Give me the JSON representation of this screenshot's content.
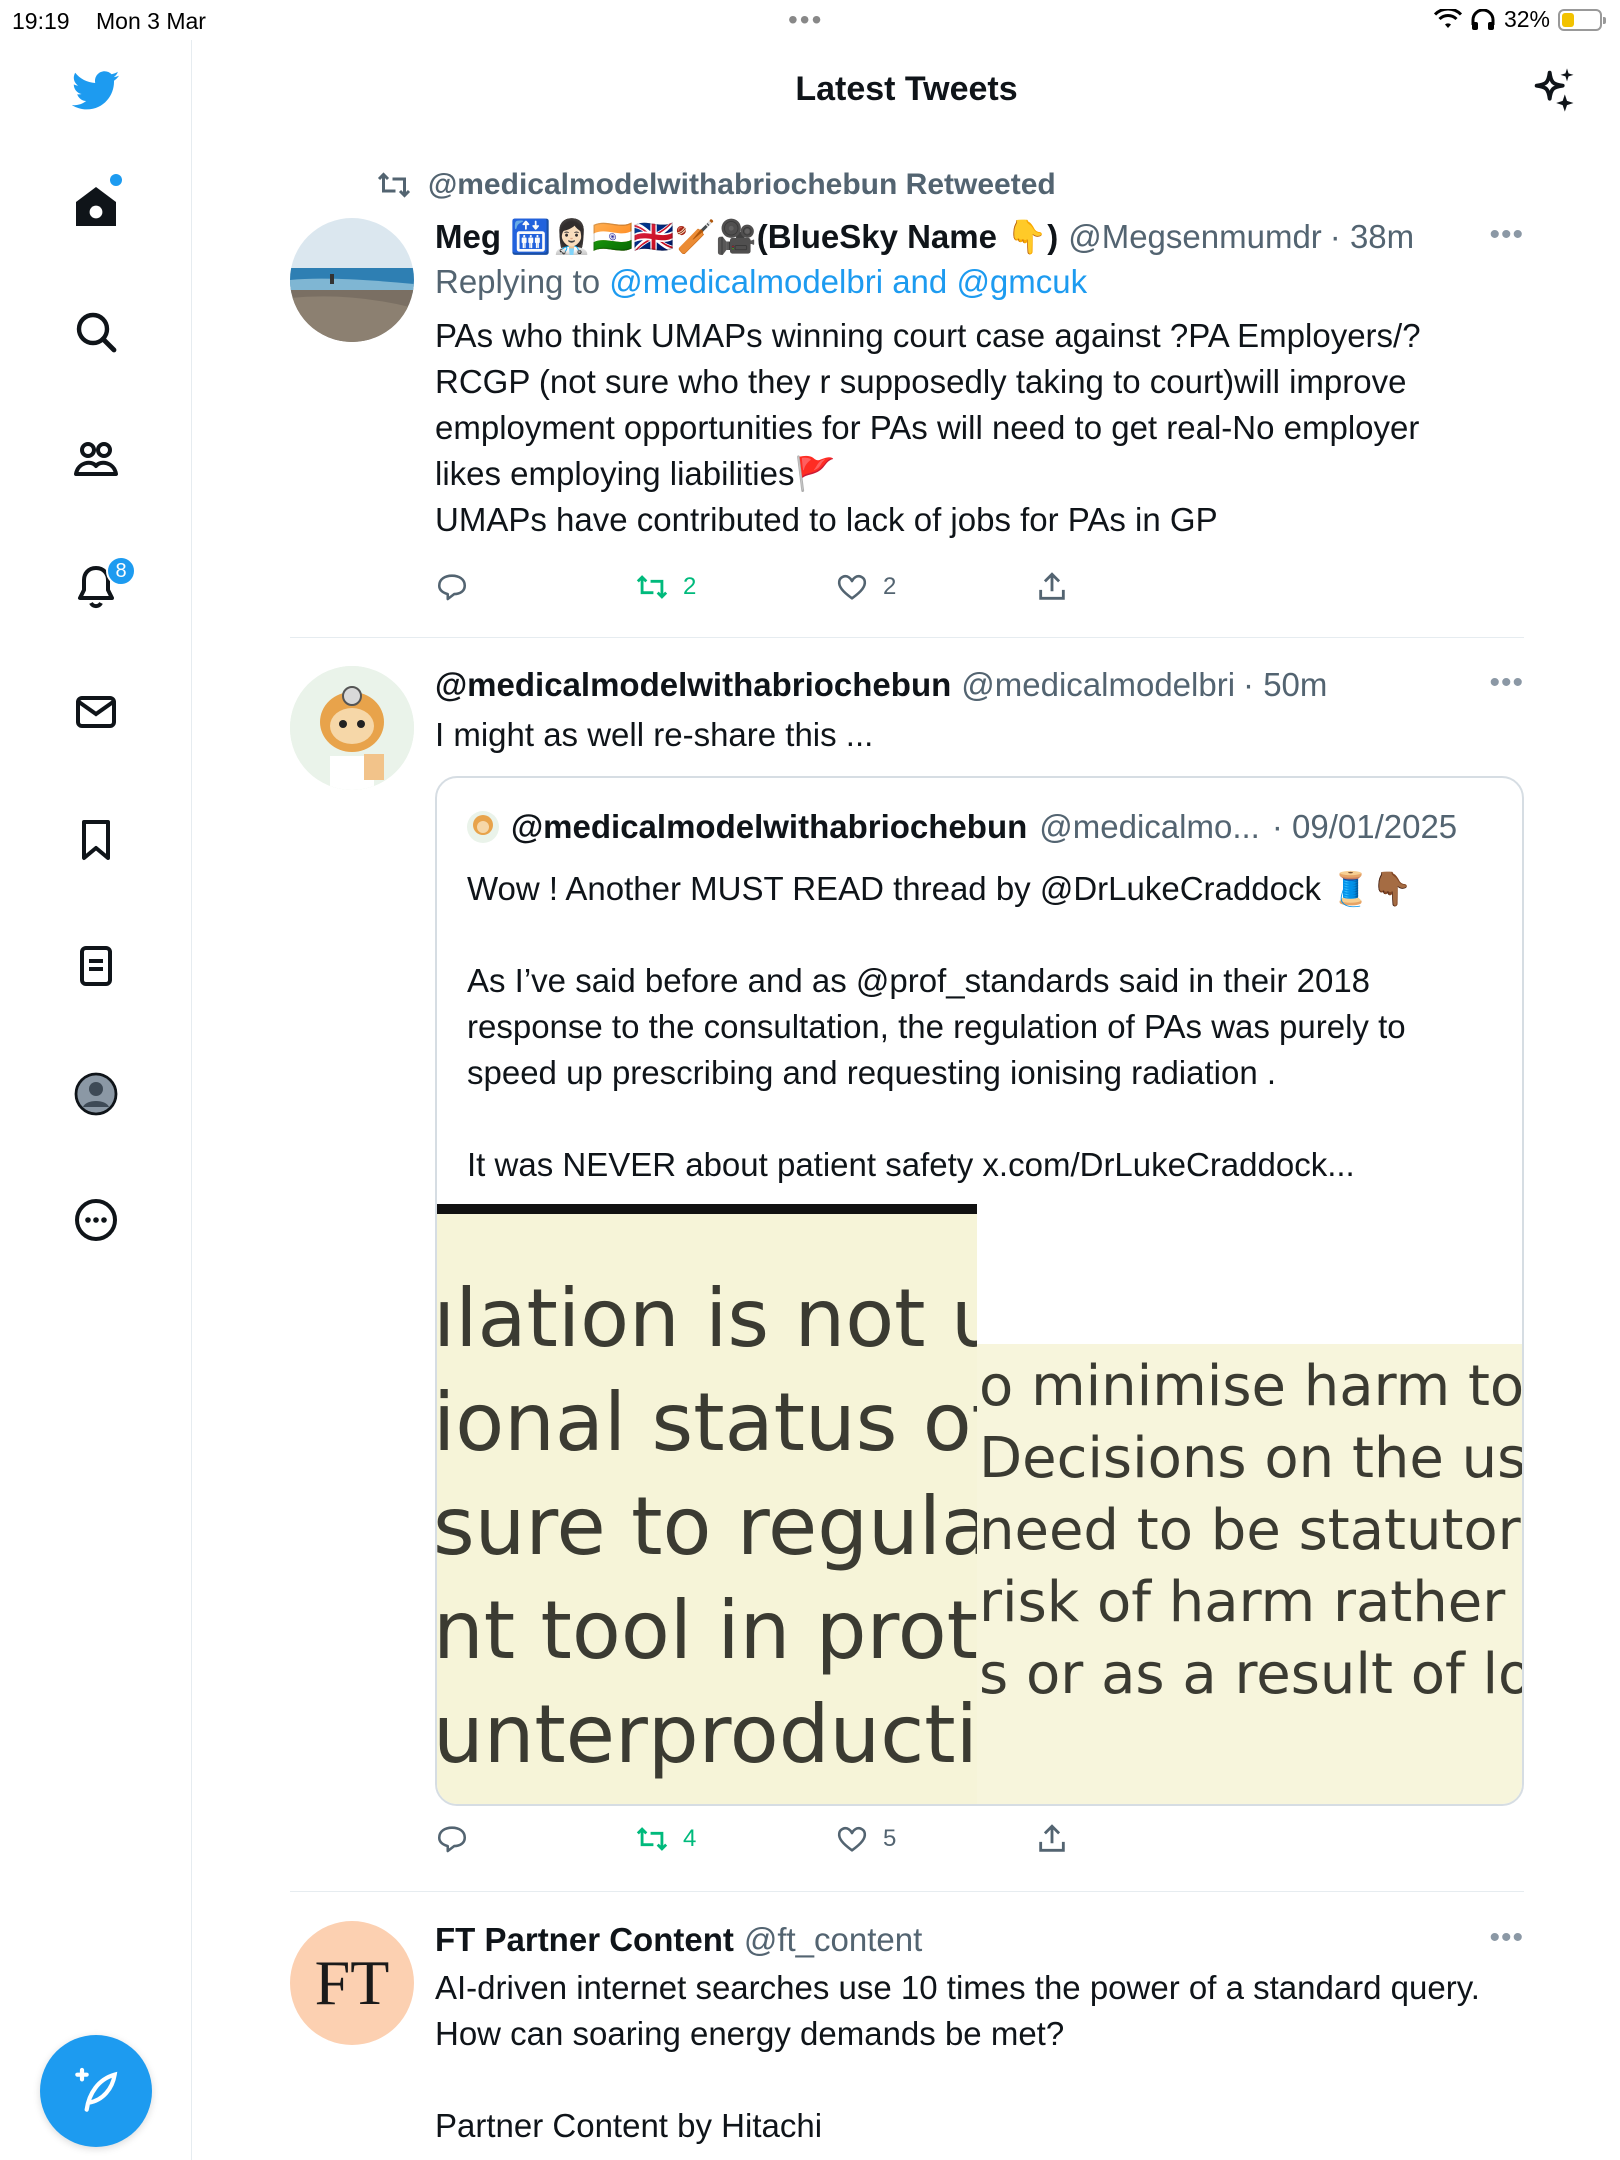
{
  "status_bar": {
    "time": "19:19",
    "date": "Mon 3 Mar",
    "battery": "32%",
    "battery_level": 0.32
  },
  "header": {
    "title": "Latest Tweets"
  },
  "sidebar": {
    "notifications_badge": "8",
    "items": [
      "twitter-logo",
      "home-icon",
      "search-icon",
      "communities-icon",
      "notifications-icon",
      "messages-icon",
      "bookmarks-icon",
      "lists-icon",
      "profile-icon",
      "more-icon"
    ]
  },
  "tweets": [
    {
      "retweeted_by": "@medicalmodelwithabriochebun Retweeted",
      "name": "Meg 🛗👩🏻‍⚕️🇮🇳🇬🇧🏏🎥(BlueSky Name 👇)",
      "handle": "@Megsenmumdr",
      "time": "· 38m",
      "replying_prefix": "Replying to ",
      "replying_to_1": "@medicalmodelbri",
      "replying_and": " and ",
      "replying_to_2": "@gmcuk",
      "text": "PAs who think UMAPs winning court case against ?PA Employers/?\nRCGP (not sure who they r supposedly taking to court)will improve\nemployment opportunities for PAs will need to get real-No employer\nlikes employing liabilities🚩\nUMAPs have contributed to lack of jobs for PAs in GP",
      "retweets": "2",
      "likes": "2"
    },
    {
      "name": "@medicalmodelwithabriochebun",
      "handle": "@medicalmodelbri",
      "time": "· 50m",
      "text": "I might as well re-share this ...",
      "quote": {
        "name": "@medicalmodelwithabriochebun",
        "handle": "@medicalmo...",
        "date": "· 09/01/2025",
        "text": "Wow ! Another MUST READ thread by @DrLukeCraddock 🧵👇🏾\n\nAs I’ve said before and as @prof_standards said in their 2018\nresponse to the consultation, the regulation of PAs was purely to\nspeed up prescribing and requesting ionising radiation .\n\nIt was NEVER about patient safety x.com/DrLukeCraddock...",
        "image_left_lines": [
          "ılation is not u",
          "ional status of",
          "sure to regulat",
          "nt tool in prote",
          "unterproductiv"
        ],
        "image_right_lines": [
          "o minimise harm to",
          "Decisions on the use",
          "need to be statutoril",
          "risk of harm rather t",
          "s or as a result of lo"
        ]
      },
      "retweets": "4",
      "likes": "5"
    },
    {
      "avatar_text": "FT",
      "name": "FT Partner Content",
      "handle": "@ft_content",
      "text": "AI-driven internet searches use 10 times the power of a standard query.\nHow can soaring energy demands be met?\n\nPartner Content by Hitachi"
    }
  ],
  "colors": {
    "accent": "#1d9bf0",
    "retweet_green": "#00ba7c",
    "secondary_text": "#536471",
    "ft_avatar": "#fcd0b1"
  }
}
